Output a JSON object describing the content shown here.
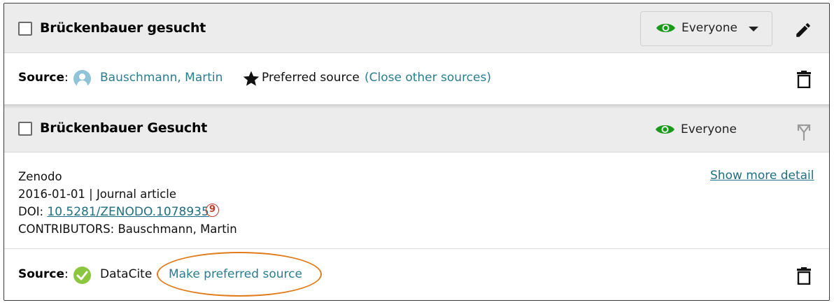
{
  "record1": {
    "title": "Brückenbauer gesucht",
    "visibility_label": "Everyone",
    "source_label": "Source",
    "source_colon": ":",
    "source_name": "Bauschmann, Martin",
    "preferred_label": "Preferred source",
    "close_other_link": "(Close other sources)"
  },
  "record2": {
    "title": "Brückenbauer Gesucht",
    "visibility_label": "Everyone",
    "publisher": "Zenodo",
    "date_type": "2016-01-01 | Journal article",
    "doi_label": "DOI:",
    "doi_value": "10.5281/ZENODO.1078935",
    "contributors": "CONTRIBUTORS: Bauschmann, Martin",
    "show_more_link": "Show more detail",
    "source_label": "Source",
    "source_colon": ":",
    "source_name": "DataCite",
    "make_preferred_link": "Make preferred source"
  },
  "colors": {
    "eye_icon": "#1a9a1a",
    "link": "#2a7d8f",
    "highlight_oval": "#e07b1b",
    "check_badge": "#8cc63f",
    "avatar": "#8fc3d8"
  },
  "icons": [
    "eye-icon",
    "caret-down-icon",
    "pencil-icon",
    "trash-icon",
    "user-avatar-icon",
    "star-icon",
    "merge-icon",
    "check-circle-icon",
    "orcid-icon"
  ]
}
